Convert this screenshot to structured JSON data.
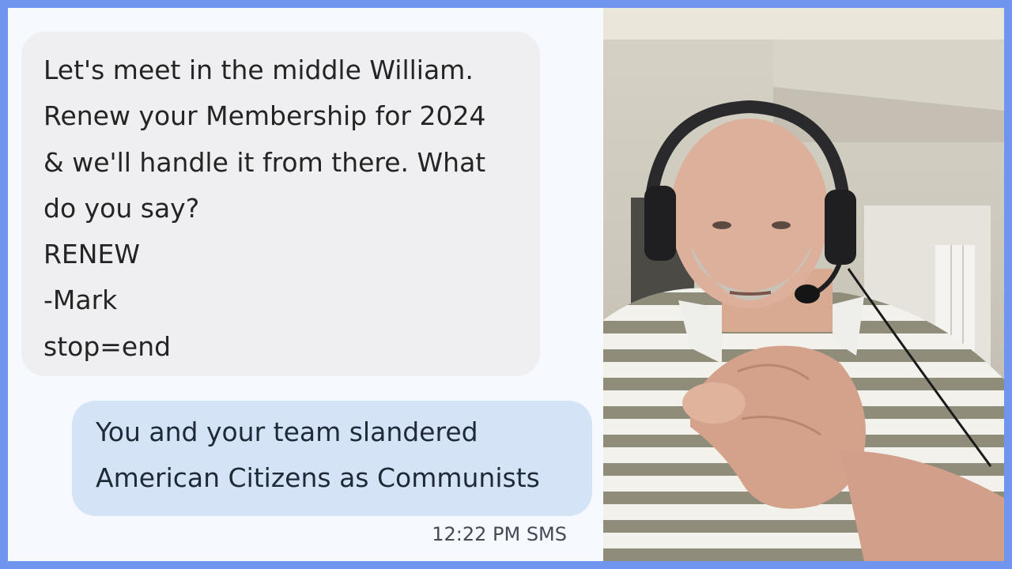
{
  "conversation": {
    "incoming": {
      "lines": [
        "Let's meet in the middle William.",
        "Renew your Membership for 2024",
        "& we'll handle it from there. What",
        "do you say?",
        "RENEW",
        "-Mark",
        "stop=end"
      ]
    },
    "outgoing": {
      "lines": [
        "You and your team slandered",
        "American Citizens as Communists"
      ]
    },
    "meta": "12:22 PM SMS"
  },
  "webcam": {
    "description_icon": "person-pointing-icon"
  },
  "colors": {
    "frame_border": "#6f95ee",
    "incoming_bubble": "#efeff1",
    "outgoing_bubble": "#d4e3f5",
    "chat_background": "#f6f9fe"
  }
}
